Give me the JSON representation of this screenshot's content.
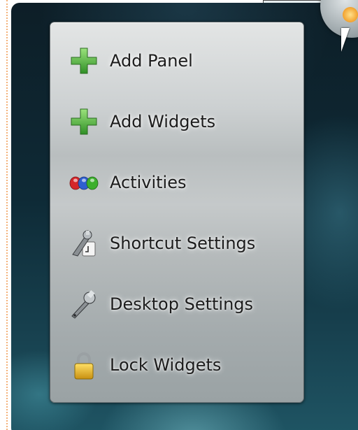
{
  "menu": {
    "items": [
      {
        "label": "Add Panel",
        "icon": "green-plus-icon"
      },
      {
        "label": "Add Widgets",
        "icon": "green-plus-icon"
      },
      {
        "label": "Activities",
        "icon": "activities-icon"
      },
      {
        "label": "Shortcut Settings",
        "icon": "shortcut-settings-icon"
      },
      {
        "label": "Desktop Settings",
        "icon": "wrench-icon"
      },
      {
        "label": "Lock Widgets",
        "icon": "padlock-icon"
      }
    ]
  },
  "colors": {
    "menu_text": "#1c1c1c",
    "plus_green": "#4db23a",
    "lock_gold": "#e6b81e",
    "desktop_dark": "#0d1e27"
  }
}
